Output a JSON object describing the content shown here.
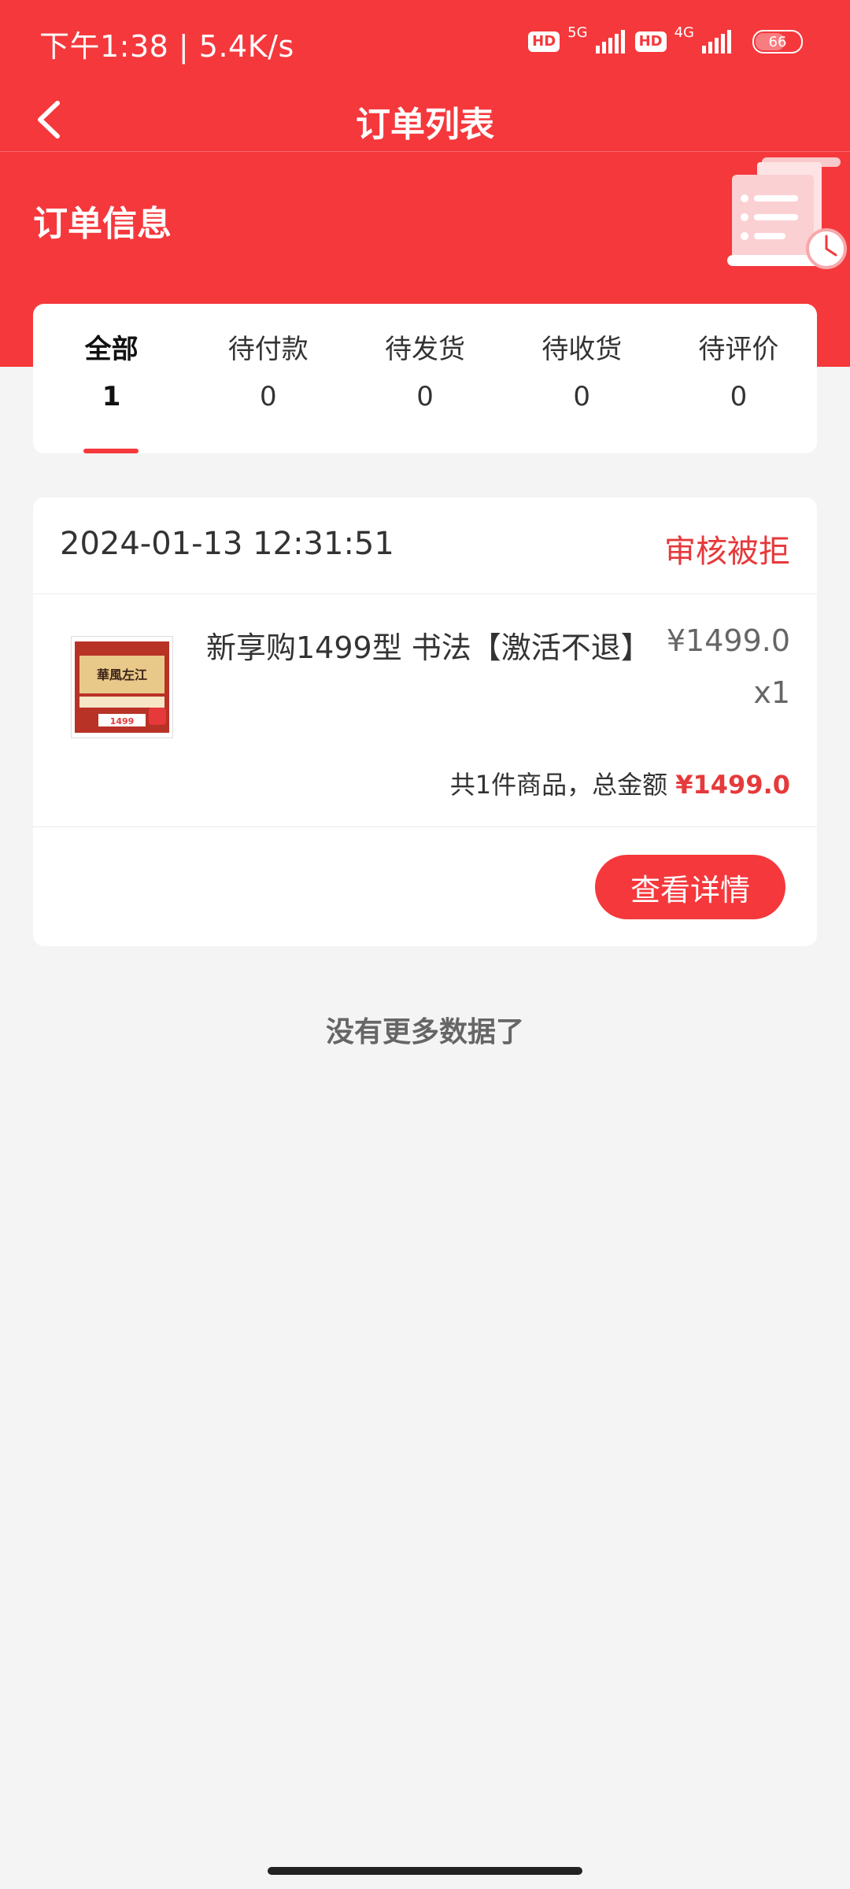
{
  "status_bar": {
    "time_speed": "下午1:38 | 5.4K/s",
    "hd1": "HD",
    "net1": "5G",
    "hd2": "HD",
    "net2": "4G",
    "battery": "66"
  },
  "nav": {
    "title": "订单列表"
  },
  "section": {
    "title": "订单信息"
  },
  "tabs": [
    {
      "label": "全部",
      "count": "1"
    },
    {
      "label": "待付款",
      "count": "0"
    },
    {
      "label": "待发货",
      "count": "0"
    },
    {
      "label": "待收货",
      "count": "0"
    },
    {
      "label": "待评价",
      "count": "0"
    }
  ],
  "order": {
    "time": "2024-01-13 12:31:51",
    "status": "审核被拒",
    "product": {
      "name": "新享购1499型  书法【激活不退】",
      "price": "¥1499.0",
      "qty": "x1",
      "thumb_text": "華風左江",
      "thumb_price": "1499"
    },
    "summary_prefix": "共1件商品，总金额",
    "summary_amount": "¥1499.0",
    "detail_button": "查看详情"
  },
  "footer": {
    "no_more": "没有更多数据了"
  },
  "colors": {
    "brand_red": "#f5383c",
    "status_red": "#e6393b",
    "background": "#f4f4f4"
  },
  "icons": {
    "back": "chevron-left-icon",
    "signal": "signal-bars-icon",
    "battery": "battery-icon",
    "illustration": "receipt-clock-icon"
  }
}
